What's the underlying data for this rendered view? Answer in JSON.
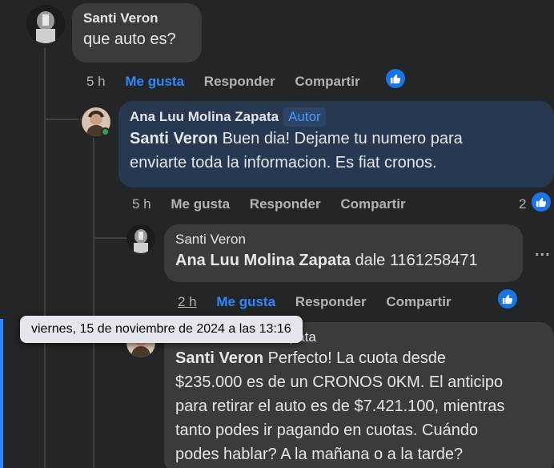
{
  "comments": [
    {
      "author": "Santi Veron",
      "text": "que auto es?",
      "time": "5 h",
      "like": "Me gusta",
      "reply": "Responder",
      "share": "Compartir"
    },
    {
      "author": "Ana Luu Molina Zapata",
      "badge": "Autor",
      "mention": "Santi Veron",
      "text_line1": " Buen dia! Dejame tu numero para",
      "text_line2": "enviarte toda la informacion. Es fiat cronos.",
      "time": "5 h",
      "like": "Me gusta",
      "reply": "Responder",
      "share": "Compartir",
      "like_count": "2"
    },
    {
      "author": "Santi Veron",
      "mention": "Ana Luu Molina Zapata",
      "text": " dale 1161258471",
      "time": "2 h",
      "like": "Me gusta",
      "reply": "Responder",
      "share": "Compartir",
      "more": "..."
    },
    {
      "author": "Ana Luu Molina Zapata",
      "mention": "Santi Veron",
      "text_line1": " Perfecto! La cuota desde",
      "text_line2": "$235.000 es de un CRONOS 0KM. El anticipo",
      "text_line3": "para retirar el auto es de $7.421.100, mientras",
      "text_line4": "tanto podes ir pagando en cuotas. Cuándo",
      "text_line5": "podes hablar? A la mañana o a la tarde?"
    }
  ],
  "tooltip": "viernes, 15 de noviembre de 2024 a las 13:16",
  "colors": {
    "accent": "#2d88ff",
    "like_badge": "#1b74e4",
    "author_bubble": "#263951"
  }
}
